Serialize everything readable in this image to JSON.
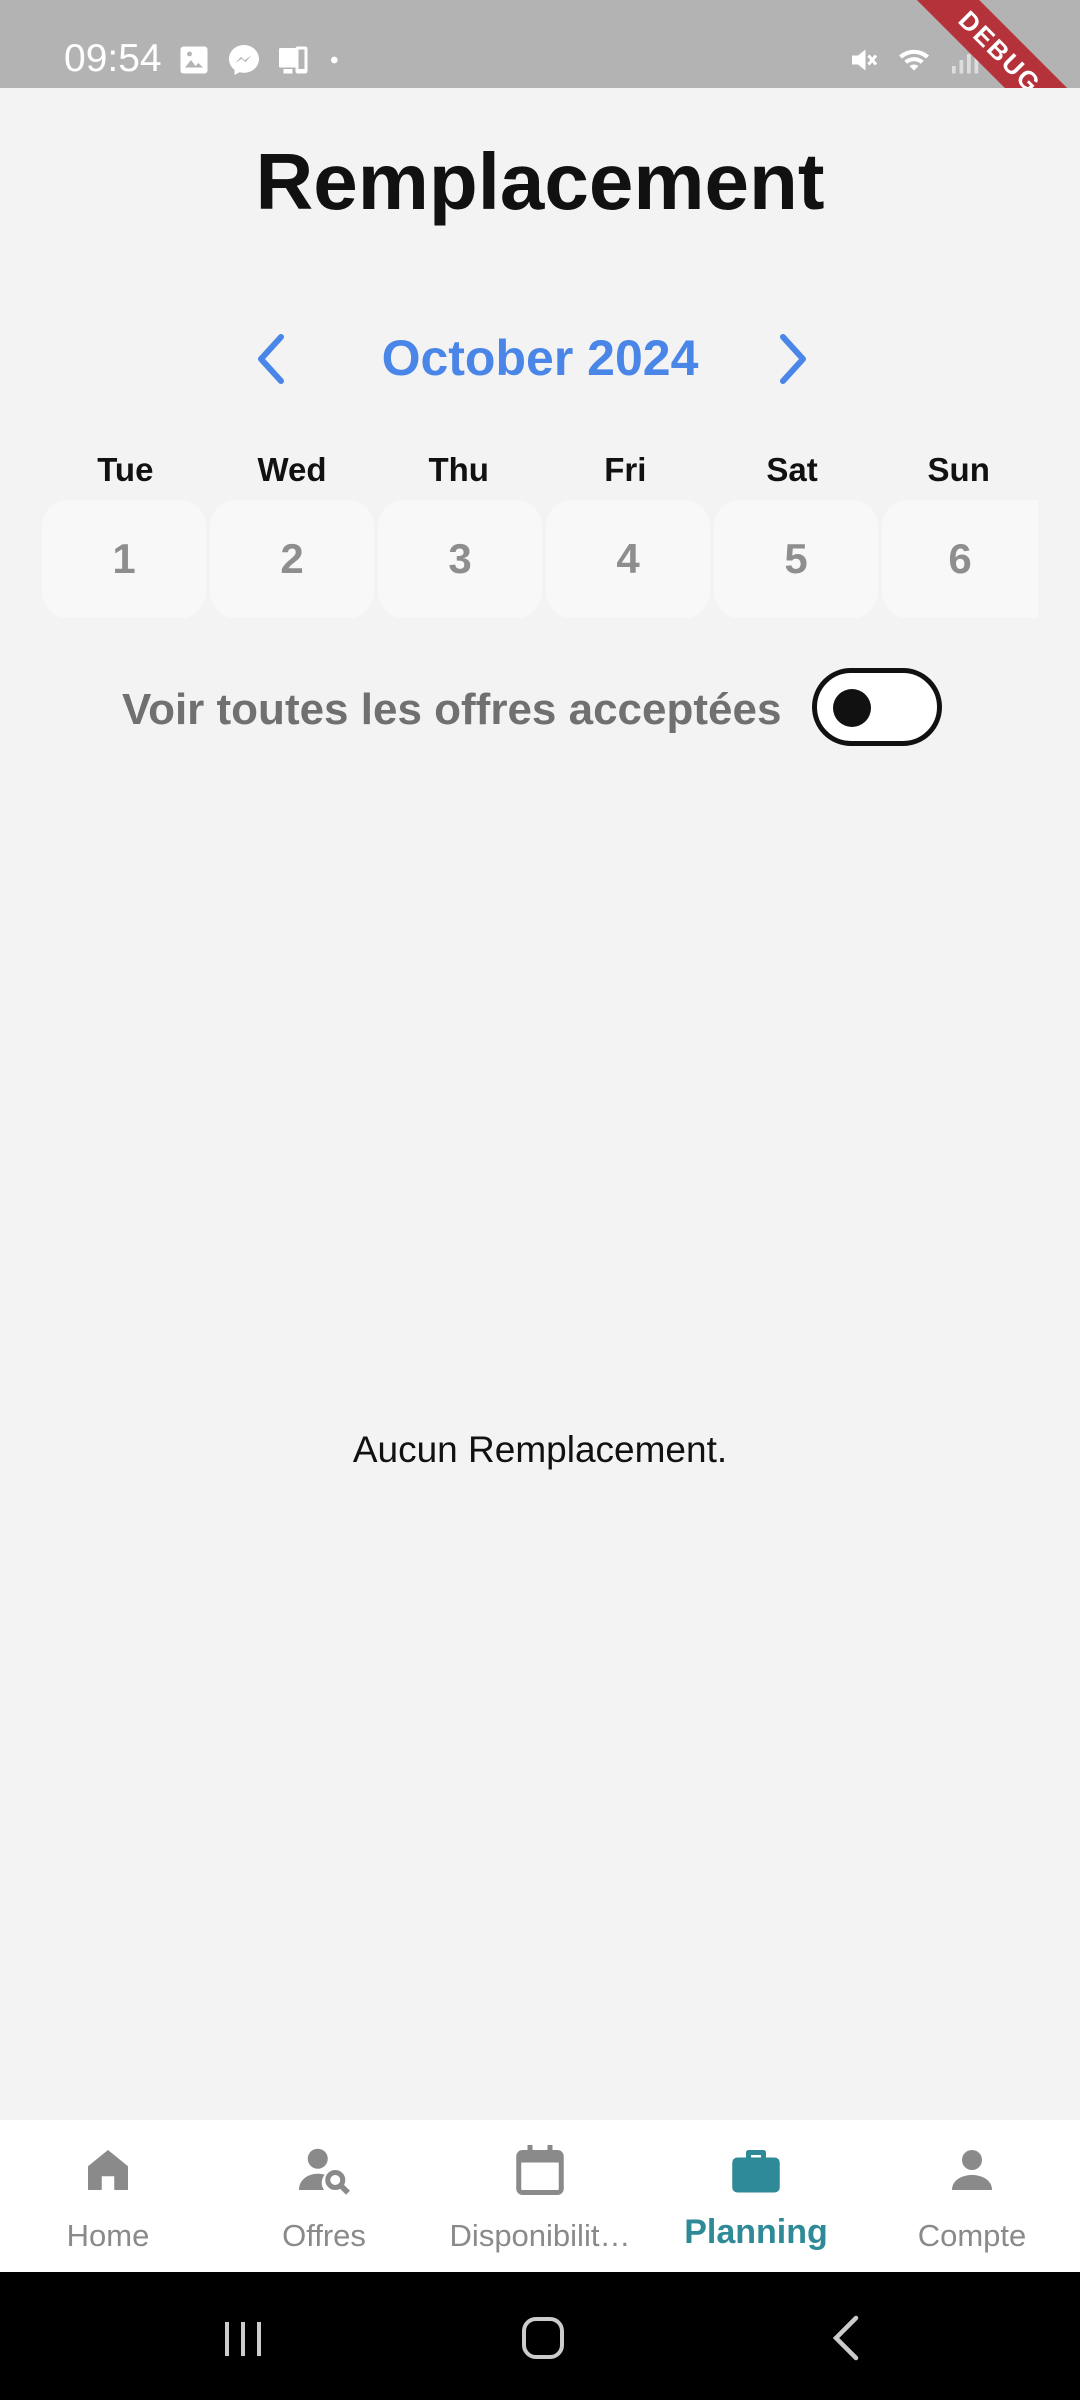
{
  "status_bar": {
    "time": "09:54",
    "left_icons": [
      "image-icon",
      "messenger-icon",
      "device-icon",
      "dot-icon"
    ],
    "right_icons": [
      "mute-icon",
      "wifi-icon",
      "signal-icon",
      "battery-icon"
    ],
    "debug_banner": "DEBUG"
  },
  "header": {
    "title": "Remplacement"
  },
  "calendar": {
    "month_label": "October 2024",
    "prev_icon": "chevron-left-icon",
    "next_icon": "chevron-right-icon",
    "weekdays": [
      "Tue",
      "Wed",
      "Thu",
      "Fri",
      "Sat",
      "Sun"
    ],
    "days": [
      "1",
      "2",
      "3",
      "4",
      "5",
      "6"
    ]
  },
  "filter": {
    "label": "Voir toutes les offres acceptées",
    "toggle_on": false
  },
  "content": {
    "empty_message": "Aucun Remplacement."
  },
  "bottom_nav": {
    "items": [
      {
        "label": "Home",
        "icon": "home-icon",
        "active": false
      },
      {
        "label": "Offres",
        "icon": "person-search-icon",
        "active": false
      },
      {
        "label": "Disponibilit…",
        "icon": "calendar-icon",
        "active": false
      },
      {
        "label": "Planning",
        "icon": "briefcase-icon",
        "active": true
      },
      {
        "label": "Compte",
        "icon": "person-icon",
        "active": false
      }
    ]
  },
  "colors": {
    "accent_blue": "#4a86e8",
    "active_teal": "#2e8a96",
    "inactive_gray": "#8a8a8a"
  }
}
